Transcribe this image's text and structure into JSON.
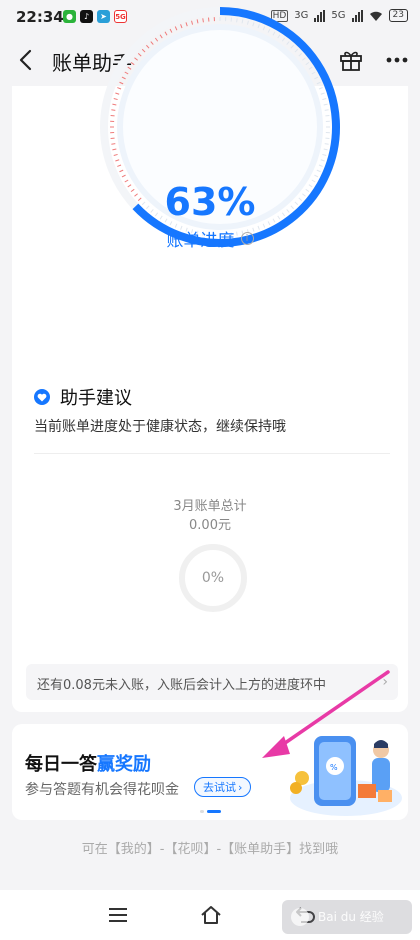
{
  "status_bar": {
    "time": "22:34",
    "network_hd": "HD",
    "network_1": "3G",
    "network_2": "5G",
    "battery": "23",
    "app_icons": [
      "wechat-icon",
      "tiktok-icon",
      "telegram-icon",
      "fiveg-icon"
    ]
  },
  "nav": {
    "title": "账单助手"
  },
  "progress": {
    "percent": "63%",
    "label": "账单进度",
    "value": 0.63,
    "accent": "#1677ff"
  },
  "advice": {
    "title": "助手建议",
    "text": "当前账单进度处于健康状态，继续保持哦"
  },
  "monthly": {
    "label": "3月账单总计",
    "amount": "0.00元",
    "percent": "0%"
  },
  "note": {
    "text": "还有0.08元未入账，入账后会计入上方的进度环中"
  },
  "promo": {
    "title_prefix": "每日一答",
    "title_highlight": "赢奖励",
    "subtitle": "参与答题有机会得花呗金",
    "button": "去试试"
  },
  "footer": {
    "hint": "可在【我的】-【花呗】-【账单助手】找到哦"
  },
  "watermark": {
    "text": "Bai du 经验"
  }
}
